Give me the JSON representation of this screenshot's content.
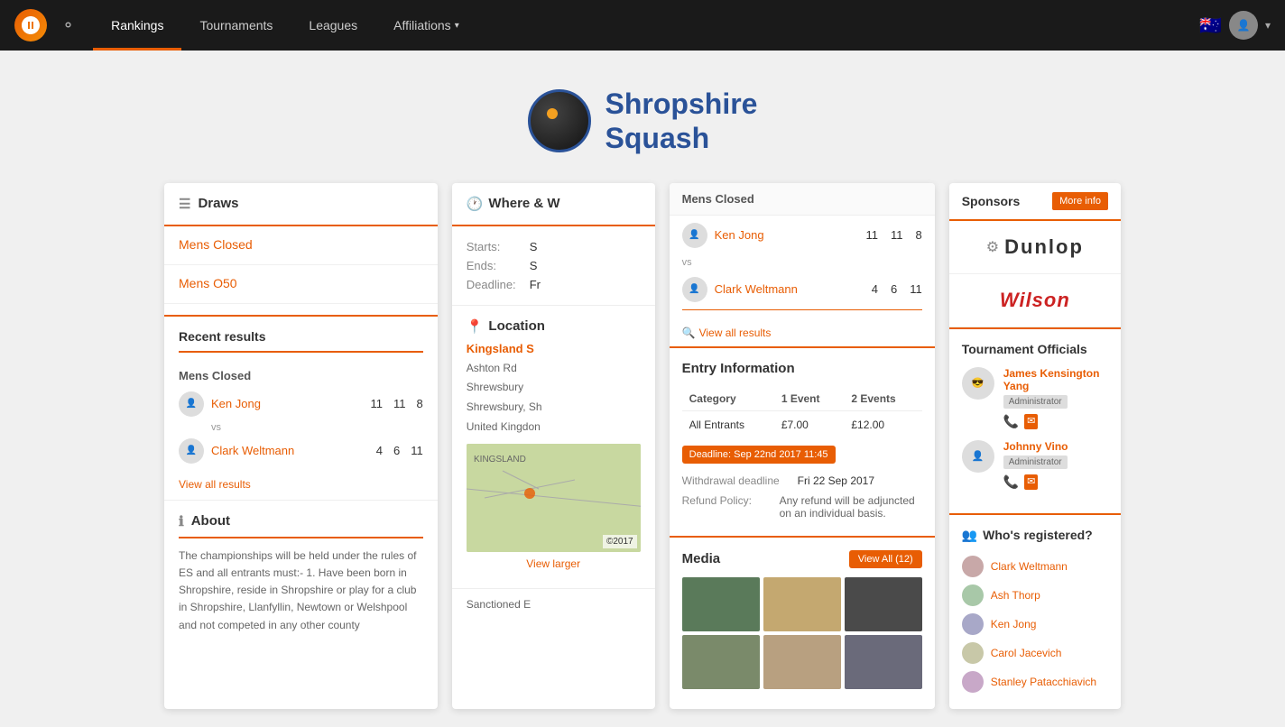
{
  "nav": {
    "items": [
      {
        "label": "Rankings",
        "active": true
      },
      {
        "label": "Tournaments",
        "active": false
      },
      {
        "label": "Leagues",
        "active": false
      },
      {
        "label": "Affiliations",
        "active": false,
        "hasDropdown": true
      }
    ],
    "search_label": "search",
    "flag_emoji": "🇦🇺"
  },
  "logo": {
    "title": "Shropshire",
    "subtitle": "Squash"
  },
  "draws": {
    "section_title": "Draws",
    "items": [
      {
        "label": "Mens Closed"
      },
      {
        "label": "Mens O50"
      }
    ]
  },
  "recent_results": {
    "section_title": "Recent results",
    "category": "Mens Closed",
    "player1": {
      "name": "Ken Jong",
      "scores": [
        "11",
        "11",
        "8"
      ]
    },
    "vs": "vs",
    "player2": {
      "name": "Clark Weltmann",
      "scores": [
        "4",
        "6",
        "11"
      ]
    },
    "view_all_label": "View all results"
  },
  "about": {
    "title": "About",
    "text": "The championships will be held under the rules of ES and all entrants must:-\n1. Have been born in Shropshire, reside in Shropshire or play for a club in Shropshire, Llanfyllin, Newtown or Welshpool and not competed in any other county"
  },
  "where": {
    "title": "Where & W",
    "starts_label": "Starts:",
    "starts_value": "S",
    "ends_label": "Ends:",
    "ends_value": "S",
    "deadline_label": "Deadline:",
    "deadline_value": "Fr"
  },
  "location": {
    "title": "Location",
    "venue_name": "Kingsland S",
    "address_lines": [
      "Ashton Rd",
      "Shrewsbury",
      "Shrewsbury, Sh",
      "United Kingdon"
    ],
    "view_larger_label": "View larger",
    "map_credit": "©2017"
  },
  "sanctioned": {
    "label": "Sanctioned E"
  },
  "match_popup": {
    "category": "Mens Closed",
    "player1": {
      "name": "Ken Jong",
      "scores": [
        "11",
        "11",
        "8"
      ]
    },
    "vs": "vs",
    "player2": {
      "name": "Clark Weltmann",
      "scores": [
        "4",
        "6",
        "11"
      ]
    },
    "view_all_label": "View all results",
    "divider_color": "#e85d04"
  },
  "entry_info": {
    "title": "Entry Information",
    "columns": [
      "Category",
      "1 Event",
      "2 Events"
    ],
    "rows": [
      {
        "category": "All Entrants",
        "event1": "£7.00",
        "event2": "£12.00"
      }
    ],
    "deadline_badge": "Deadline: Sep 22nd 2017 11:45",
    "withdrawal_label": "Withdrawal deadline",
    "withdrawal_value": "Fri 22 Sep 2017",
    "refund_label": "Refund Policy:",
    "refund_value": "Any refund will be adjuncted on an individual basis."
  },
  "media": {
    "title": "Media",
    "view_all_label": "View All (12)",
    "thumbs": [
      1,
      2,
      3,
      4,
      5,
      6
    ]
  },
  "sponsors": {
    "title": "Sponsors",
    "more_info_label": "More info",
    "logos": [
      {
        "name": "Dunlop"
      },
      {
        "name": "Wilson"
      }
    ]
  },
  "officials": {
    "title": "Tournament Officials",
    "people": [
      {
        "name": "James Kensington Yang",
        "role": "Administrator"
      },
      {
        "name": "Johnny Vino",
        "role": "Administrator"
      }
    ]
  },
  "registered": {
    "title": "Who's registered?",
    "people": [
      {
        "name": "Clark Weltmann"
      },
      {
        "name": "Ash Thorp"
      },
      {
        "name": "Ken Jong"
      },
      {
        "name": "Carol Jacevich"
      },
      {
        "name": "Stanley Patacchiavich"
      }
    ]
  }
}
